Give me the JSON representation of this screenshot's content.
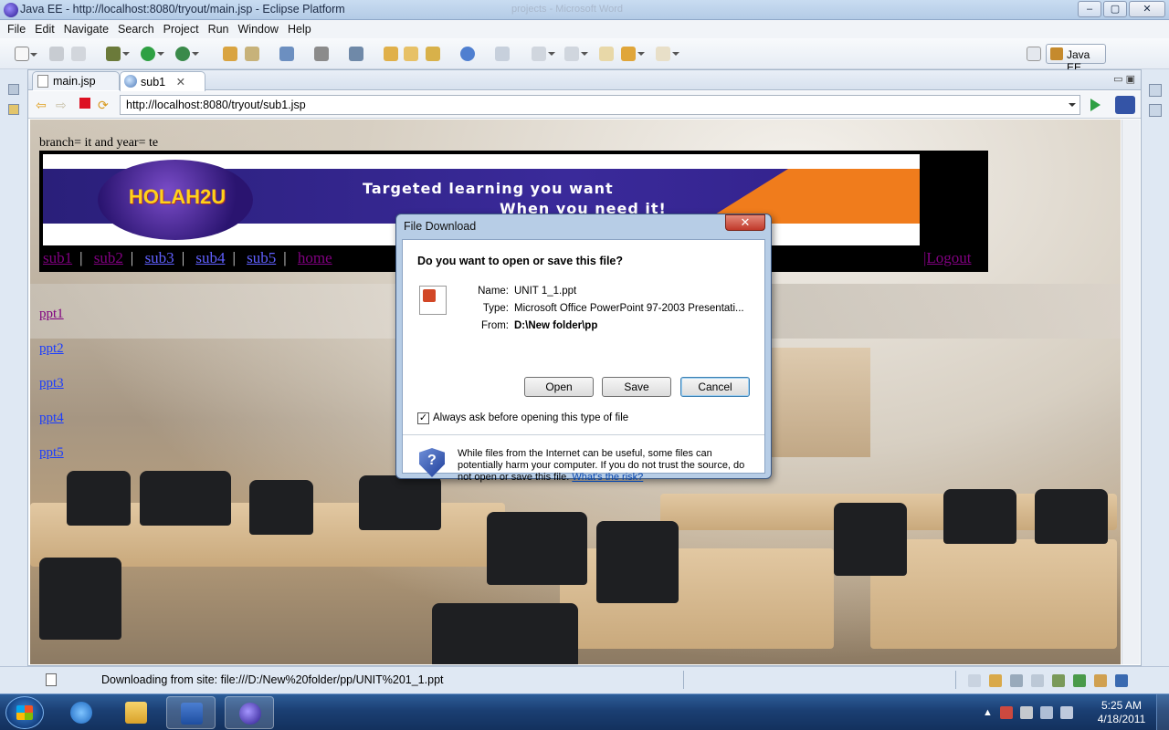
{
  "window": {
    "title": "Java EE - http://localhost:8080/tryout/main.jsp - Eclipse Platform",
    "bg_faded_title": "projects - Microsoft Word",
    "buttons": [
      "‒",
      "▢",
      "✕"
    ]
  },
  "menu": [
    "File",
    "Edit",
    "Navigate",
    "Search",
    "Project",
    "Run",
    "Window",
    "Help"
  ],
  "perspective": {
    "label": "Java EE"
  },
  "tabs": [
    {
      "label": "main.jsp",
      "active": false
    },
    {
      "label": "sub1",
      "active": true,
      "close": "✕"
    }
  ],
  "browser": {
    "url": "http://localhost:8080/tryout/sub1.jsp"
  },
  "page": {
    "branch_line": "branch= it and year= te",
    "banner": {
      "logo_text": "HOLAH2U",
      "tagline1": "Targeted learning you want",
      "tagline2": "When you need it!"
    },
    "nav": [
      {
        "label": "sub1",
        "visited": true
      },
      {
        "label": "sub2",
        "visited": true
      },
      {
        "label": "sub3",
        "visited": false
      },
      {
        "label": "sub4",
        "visited": false
      },
      {
        "label": "sub5",
        "visited": false
      },
      {
        "label": "home",
        "visited": true
      }
    ],
    "logout": "|Logout",
    "ppt_links": [
      {
        "label": "ppt1",
        "visited": true
      },
      {
        "label": "ppt2",
        "visited": false
      },
      {
        "label": "ppt3",
        "visited": false
      },
      {
        "label": "ppt4",
        "visited": false
      },
      {
        "label": "ppt5",
        "visited": false
      }
    ]
  },
  "dialog": {
    "title": "File Download",
    "close": "✕",
    "question": "Do you want to open or save this file?",
    "name_label": "Name:",
    "name_value": "UNIT 1_1.ppt",
    "type_label": "Type:",
    "type_value": "Microsoft Office PowerPoint 97-2003 Presentati...",
    "from_label": "From:",
    "from_value": "D:\\New folder\\pp",
    "open_label": "Open",
    "save_label": "Save",
    "cancel_label": "Cancel",
    "checkbox_label": "Always ask before opening this type of file",
    "checkbox_checked": true,
    "warning": "While files from the Internet can be useful, some files can potentially harm your computer. If you do not trust the source, do not open or save this file.",
    "risk_link": "What's the risk?"
  },
  "status": {
    "text": "Downloading from site: file:///D:/New%20folder/pp/UNIT%201_1.ppt"
  },
  "taskbar": {
    "time": "5:25 AM",
    "date": "4/18/2011"
  }
}
